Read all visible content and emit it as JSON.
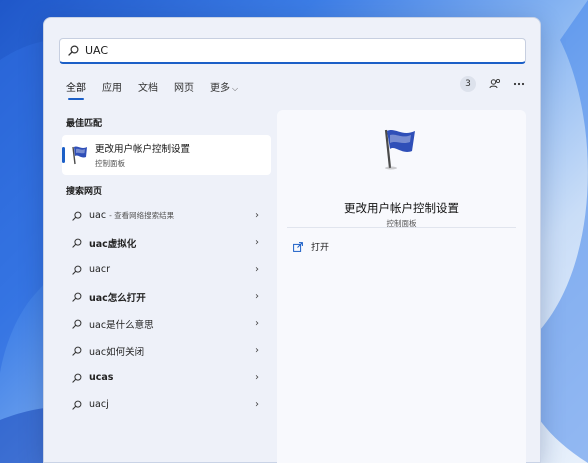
{
  "search": {
    "value": "UAC"
  },
  "tabs": [
    {
      "label": "全部",
      "active": true
    },
    {
      "label": "应用"
    },
    {
      "label": "文档"
    },
    {
      "label": "网页"
    },
    {
      "label": "更多",
      "dropdown": true
    }
  ],
  "toolbar": {
    "badge_count": "3"
  },
  "sections": {
    "best_match": "最佳匹配",
    "web_search": "搜索网页"
  },
  "best_match": {
    "title": "更改用户帐户控制设置",
    "subtitle": "控制面板"
  },
  "web_results": [
    {
      "label": "uac",
      "hint": "- 查看网络搜索结果",
      "bold": false
    },
    {
      "label": "uac虚拟化",
      "hint": "",
      "bold": true
    },
    {
      "label": "uacr",
      "hint": "",
      "bold": false
    },
    {
      "label": "uac怎么打开",
      "hint": "",
      "bold": true
    },
    {
      "label": "uac是什么意思",
      "hint": "",
      "bold": false
    },
    {
      "label": "uac如何关闭",
      "hint": "",
      "bold": false
    },
    {
      "label": "ucas",
      "hint": "",
      "bold": true
    },
    {
      "label": "uacj",
      "hint": "",
      "bold": false
    }
  ],
  "detail": {
    "title": "更改用户帐户控制设置",
    "subtitle": "控制面板",
    "action_open": "打开"
  },
  "colors": {
    "accent": "#1b5fc7",
    "panel_bg": "#eef1f9",
    "card_bg": "#ffffff"
  }
}
